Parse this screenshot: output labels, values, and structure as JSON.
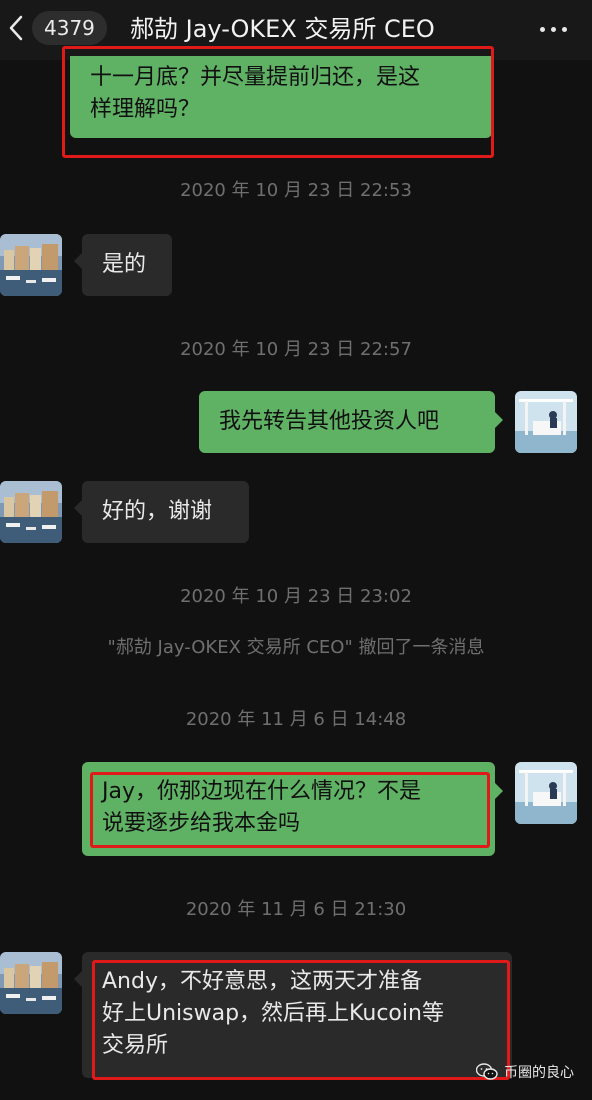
{
  "header": {
    "unread_count": "4379",
    "title": "郝劼 Jay-OKEX 交易所 CEO",
    "back_icon": "chevron-left-icon",
    "more_icon": "more-dots-icon"
  },
  "messages": [
    {
      "side": "out",
      "text_line1": "十一月底？并尽量提前归还，是这",
      "text_line2": "样理解吗？"
    },
    {
      "side": "in",
      "text": "是的"
    },
    {
      "side": "out",
      "text": "我先转告其他投资人吧"
    },
    {
      "side": "in",
      "text": "好的，谢谢"
    },
    {
      "side": "out",
      "text_line1": "Jay，你那边现在什么情况？不是",
      "text_line2": "说要逐步给我本金吗"
    },
    {
      "side": "in",
      "text_line1": "Andy，不好意思，这两天才准备",
      "text_line2": "好上Uniswap，然后再上Kucoin等",
      "text_line3": "交易所"
    }
  ],
  "timestamps": {
    "t1": "2020 年 10 月 23 日 22:53",
    "t2": "2020 年 10 月 23 日 22:57",
    "t3": "2020 年 10 月 23 日 23:02",
    "t4": "2020 年 11 月 6 日 14:48",
    "t5": "2020 年 11 月 6 日 21:30"
  },
  "notice": "\"郝劼 Jay-OKEX 交易所 CEO\" 撤回了一条消息",
  "watermark": "币圈的良心",
  "colors": {
    "background": "#111111",
    "outgoing_bubble": "#5fb164",
    "incoming_bubble": "#2a2a2a",
    "highlight_box": "#e01919"
  }
}
